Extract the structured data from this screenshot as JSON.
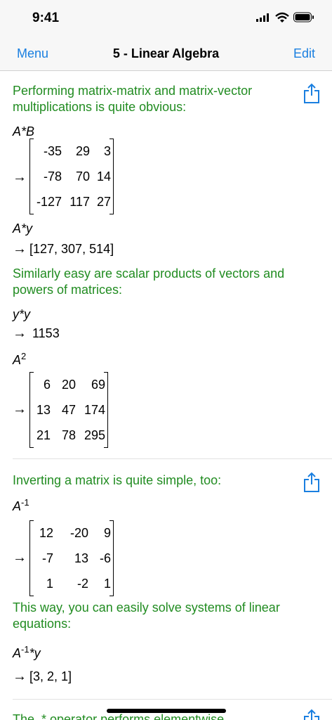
{
  "status": {
    "time": "9:41"
  },
  "nav": {
    "left": "Menu",
    "title": "5 - Linear Algebra",
    "right": "Edit"
  },
  "s1": {
    "text": "Performing matrix-matrix and matrix-vector multiplications is quite obvious:",
    "expr1": "A*B",
    "m1": [
      [
        "-35",
        "29",
        "3"
      ],
      [
        "-78",
        "70",
        "14"
      ],
      [
        "-127",
        "117",
        "27"
      ]
    ],
    "expr2": "A*y",
    "v1": "[127, 307, 514]",
    "text2": "Similarly easy are scalar products of vectors and powers of matrices:",
    "expr3": "y*y",
    "r3": "1153",
    "expr4_base": "A",
    "expr4_sup": "2",
    "m2": [
      [
        "6",
        "20",
        "69"
      ],
      [
        "13",
        "47",
        "174"
      ],
      [
        "21",
        "78",
        "295"
      ]
    ]
  },
  "s2": {
    "text": "Inverting a matrix is quite simple, too:",
    "expr_base": "A",
    "expr_sup": "-1",
    "m3": [
      [
        "12",
        "-20",
        "9"
      ],
      [
        "-7",
        "13",
        "-6"
      ],
      [
        "1",
        "-2",
        "1"
      ]
    ],
    "text2": "This way, you can easily solve systems of linear equations:",
    "expr2_base": "A",
    "expr2_sup": "-1",
    "expr2_tail": "*y",
    "v2": "[3, 2, 1]"
  },
  "s3": {
    "text": "The .* operator performs elementwise"
  },
  "arrow": "→",
  "colors": {
    "accent": "#1a7fe0",
    "text_green": "#218c21"
  }
}
